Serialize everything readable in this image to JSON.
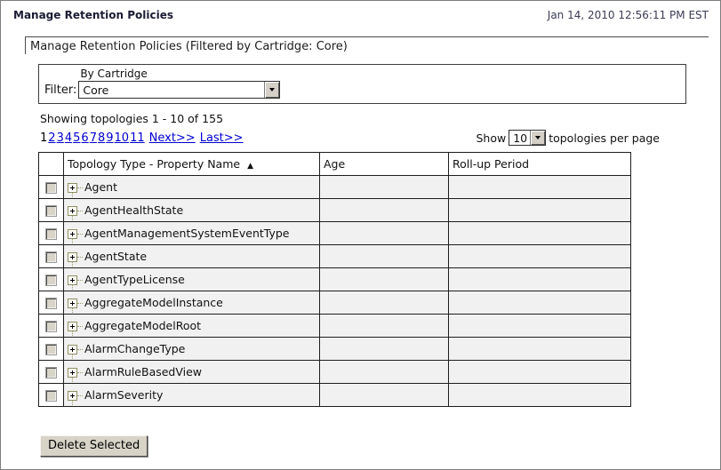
{
  "header": {
    "title": "Manage Retention Policies",
    "timestamp": "Jan 14, 2010 12:56:11 PM EST"
  },
  "panel": {
    "title": "Manage Retention Policies (Filtered by Cartridge: Core)"
  },
  "filter": {
    "label": "Filter:",
    "field_label": "By Cartridge",
    "selected_value": "Core"
  },
  "summary": {
    "showing_text": "Showing topologies 1 - 10 of 155"
  },
  "pagination": {
    "current_page": "1",
    "pages": [
      "2",
      "3",
      "4",
      "5",
      "6",
      "7",
      "8",
      "9",
      "10",
      "11"
    ],
    "next_label": "Next>>",
    "last_label": "Last>>"
  },
  "page_size": {
    "show_label": "Show",
    "selected_value": "10",
    "suffix_label": "topologies per page"
  },
  "table": {
    "columns": {
      "name": "Topology Type - Property Name",
      "sort_indicator": "▲",
      "age": "Age",
      "rollup": "Roll-up Period"
    },
    "rows": [
      {
        "name": "Agent",
        "age": "",
        "rollup": ""
      },
      {
        "name": "AgentHealthState",
        "age": "",
        "rollup": ""
      },
      {
        "name": "AgentManagementSystemEventType",
        "age": "",
        "rollup": ""
      },
      {
        "name": "AgentState",
        "age": "",
        "rollup": ""
      },
      {
        "name": "AgentTypeLicense",
        "age": "",
        "rollup": ""
      },
      {
        "name": "AggregateModelInstance",
        "age": "",
        "rollup": ""
      },
      {
        "name": "AggregateModelRoot",
        "age": "",
        "rollup": ""
      },
      {
        "name": "AlarmChangeType",
        "age": "",
        "rollup": ""
      },
      {
        "name": "AlarmRuleBasedView",
        "age": "",
        "rollup": ""
      },
      {
        "name": "AlarmSeverity",
        "age": "",
        "rollup": ""
      }
    ]
  },
  "actions": {
    "delete_button_label": "Delete Selected"
  },
  "colors": {
    "link": "#0000cc",
    "row_bg": "#f1f1f1",
    "table_border": "#1e1e1e",
    "button_face": "#d7d3c7"
  }
}
